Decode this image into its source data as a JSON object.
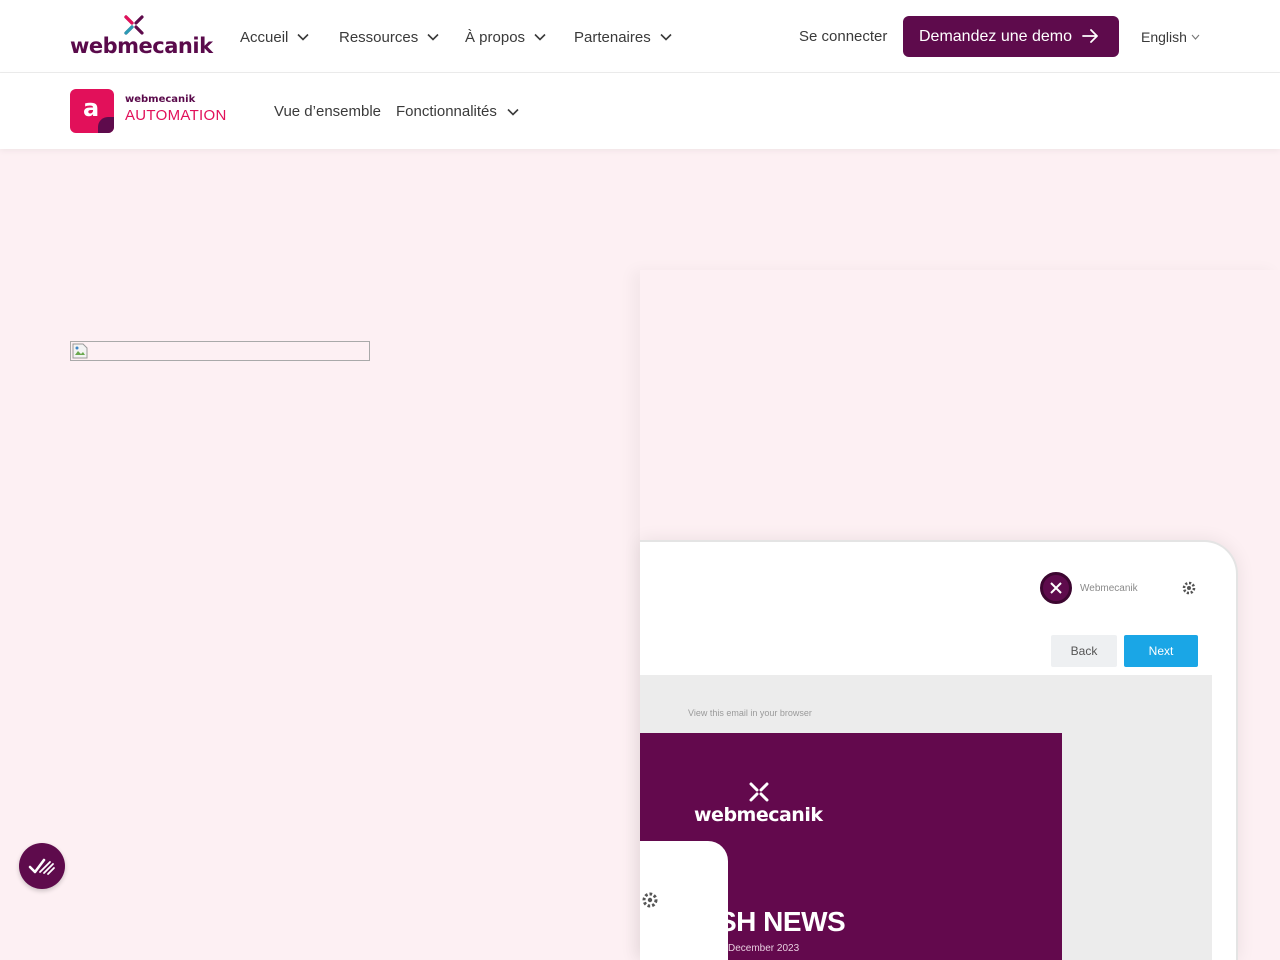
{
  "header": {
    "brand": "webmecanik",
    "nav": [
      {
        "label": "Accueil"
      },
      {
        "label": "Ressources"
      },
      {
        "label": "À propos"
      },
      {
        "label": "Partenaires"
      }
    ],
    "login_label": "Se connecter",
    "demo_label": "Demandez une demo",
    "language": "English"
  },
  "subheader": {
    "logo_letter": "a",
    "logo_brand": "webmecanik",
    "logo_product": "AUTOMATION",
    "nav": [
      {
        "label": "Vue d’ensemble"
      },
      {
        "label": "Fonctionnalités"
      }
    ]
  },
  "product_screen": {
    "user_name": "Webmecanik",
    "back_label": "Back",
    "next_label": "Next",
    "preview_link": "View this email in your browser",
    "newsletter_brand": "webmecanik",
    "newsletter_headline": "SH NEWS",
    "newsletter_date": "December 2023"
  },
  "colors": {
    "brand_purple": "#5e0b4c",
    "automation_pink": "#e2105a",
    "page_background": "#fdf0f3",
    "next_button": "#1aa6e6"
  },
  "icons": [
    "webmecanik-logo-icon",
    "chevron-down-icon",
    "arrow-right-icon",
    "broken-image-icon",
    "gear-icon",
    "cookie-consent-icon"
  ]
}
